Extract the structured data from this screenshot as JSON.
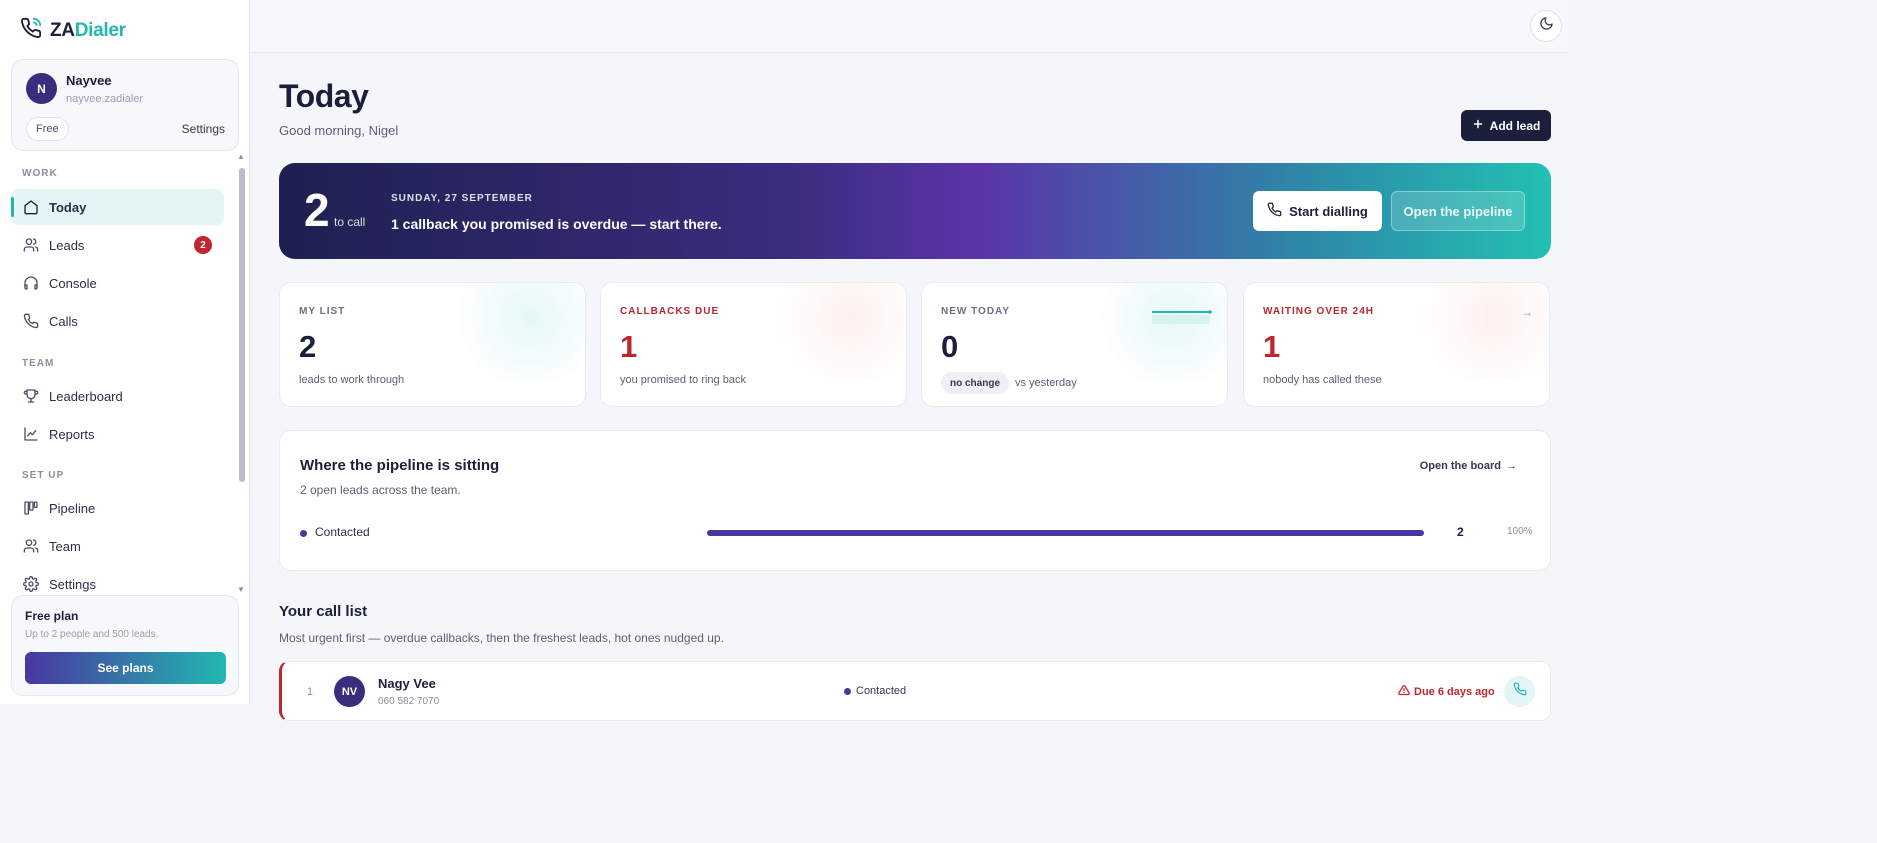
{
  "brand": {
    "prefix": "ZA",
    "suffix": "Dialer"
  },
  "profile": {
    "initial": "N",
    "name": "Nayvee",
    "handle": "nayvee.zadialer",
    "plan": "Free",
    "settings_label": "Settings"
  },
  "nav": {
    "work_label": "WORK",
    "team_label": "TEAM",
    "setup_label": "SET UP",
    "today": "Today",
    "leads": "Leads",
    "leads_badge": "2",
    "console": "Console",
    "calls": "Calls",
    "leaderboard": "Leaderboard",
    "reports": "Reports",
    "pipeline": "Pipeline",
    "team": "Team",
    "settings": "Settings"
  },
  "free_plan": {
    "title": "Free plan",
    "subtitle": "Up to 2 people and 500 leads.",
    "button": "See plans"
  },
  "header": {
    "title": "Today",
    "greeting": "Good morning, Nigel",
    "add_lead": "Add lead"
  },
  "hero": {
    "count": "2",
    "count_label": "to call",
    "date": "SUNDAY, 27 SEPTEMBER",
    "message": "1 callback you promised is overdue — start there.",
    "start_button": "Start dialling",
    "pipeline_button": "Open the pipeline"
  },
  "stats": {
    "my_list": {
      "label": "MY LIST",
      "value": "2",
      "sub": "leads to work through"
    },
    "callbacks": {
      "label": "CALLBACKS DUE",
      "value": "1",
      "sub": "you promised to ring back"
    },
    "new_today": {
      "label": "NEW TODAY",
      "value": "0",
      "change": "no change",
      "sub": "vs yesterday"
    },
    "waiting": {
      "label": "WAITING OVER 24H",
      "value": "1",
      "sub": "nobody has called these"
    }
  },
  "pipeline": {
    "title": "Where the pipeline is sitting",
    "subtitle": "2 open leads across the team.",
    "open_board": "Open the board",
    "stage": {
      "name": "Contacted",
      "count": "2",
      "percent": "100%",
      "fraction": 1.0
    }
  },
  "call_list": {
    "title": "Your call list",
    "subtitle": "Most urgent first — overdue callbacks, then the freshest leads, hot ones nudged up.",
    "rows": [
      {
        "rank": "1",
        "initials": "NV",
        "name": "Nagy Vee",
        "phone": "060 582 7070",
        "stage": "Contacted",
        "due": "Due 6 days ago"
      }
    ]
  },
  "colors": {
    "accent": "#22b8b0",
    "primary": "#1b1f3b",
    "purple": "#4a36a0",
    "danger": "#c0262d"
  },
  "icons": [
    "phone-logo-icon",
    "home-icon",
    "users-icon",
    "headset-icon",
    "phone-icon",
    "trophy-icon",
    "chart-line-icon",
    "kanban-icon",
    "team-icon",
    "gear-icon",
    "moon-icon",
    "plus-icon",
    "arrow-right-icon",
    "warning-icon"
  ]
}
